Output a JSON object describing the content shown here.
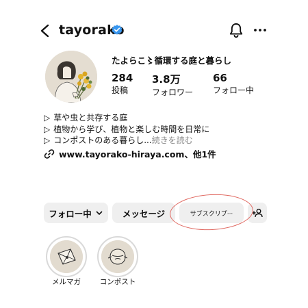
{
  "header": {
    "username": "tayorako",
    "icons": [
      "back-icon",
      "verified-badge-icon",
      "bell-icon",
      "more-icon"
    ]
  },
  "profile": {
    "display_name": "たよらこ〻循環する庭と暮らし",
    "stats": [
      {
        "value": "284",
        "label": "投稿"
      },
      {
        "value": "3.8万",
        "label": "フォロワー"
      },
      {
        "value": "66",
        "label": "フォロー中"
      }
    ],
    "bio": [
      "草や虫と共存する庭",
      "植物から学び、植物と楽しむ時間を日常に",
      "コンポストのある暮らし..."
    ],
    "bio_bullet": "▷",
    "more_label": "続きを読む",
    "link": "www.tayorako-hiraya.com、他1件"
  },
  "actions": {
    "follow_label": "フォロー中",
    "message_label": "メッセージ",
    "subscribe_label": "サブスクリプ···"
  },
  "highlights": [
    {
      "label": "メルマガ"
    },
    {
      "label": "コンポスト"
    }
  ],
  "colors": {
    "verified": "#3897f0",
    "button_bg": "#efefef",
    "annotation": "#e06860",
    "muted_text": "#8a8a8a"
  }
}
